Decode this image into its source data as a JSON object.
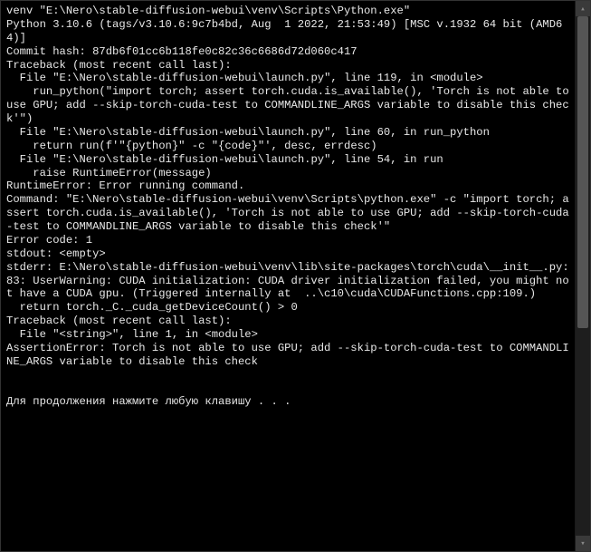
{
  "console": {
    "lines": [
      "venv \"E:\\Nero\\stable-diffusion-webui\\venv\\Scripts\\Python.exe\"",
      "Python 3.10.6 (tags/v3.10.6:9c7b4bd, Aug  1 2022, 21:53:49) [MSC v.1932 64 bit (AMD64)]",
      "Commit hash: 87db6f01cc6b118fe0c82c36c6686d72d060c417",
      "Traceback (most recent call last):",
      "  File \"E:\\Nero\\stable-diffusion-webui\\launch.py\", line 119, in <module>",
      "    run_python(\"import torch; assert torch.cuda.is_available(), 'Torch is not able to use GPU; add --skip-torch-cuda-test to COMMANDLINE_ARGS variable to disable this check'\")",
      "  File \"E:\\Nero\\stable-diffusion-webui\\launch.py\", line 60, in run_python",
      "    return run(f'\"{python}\" -c \"{code}\"', desc, errdesc)",
      "  File \"E:\\Nero\\stable-diffusion-webui\\launch.py\", line 54, in run",
      "    raise RuntimeError(message)",
      "RuntimeError: Error running command.",
      "Command: \"E:\\Nero\\stable-diffusion-webui\\venv\\Scripts\\python.exe\" -c \"import torch; assert torch.cuda.is_available(), 'Torch is not able to use GPU; add --skip-torch-cuda-test to COMMANDLINE_ARGS variable to disable this check'\"",
      "Error code: 1",
      "stdout: <empty>",
      "stderr: E:\\Nero\\stable-diffusion-webui\\venv\\lib\\site-packages\\torch\\cuda\\__init__.py:83: UserWarning: CUDA initialization: CUDA driver initialization failed, you might not have a CUDA gpu. (Triggered internally at  ..\\c10\\cuda\\CUDAFunctions.cpp:109.)",
      "  return torch._C._cuda_getDeviceCount() > 0",
      "Traceback (most recent call last):",
      "  File \"<string>\", line 1, in <module>",
      "AssertionError: Torch is not able to use GPU; add --skip-torch-cuda-test to COMMANDLINE_ARGS variable to disable this check",
      "",
      "",
      "Для продолжения нажмите любую клавишу . . ."
    ]
  },
  "scrollbar": {
    "up_glyph": "▴",
    "down_glyph": "▾"
  }
}
